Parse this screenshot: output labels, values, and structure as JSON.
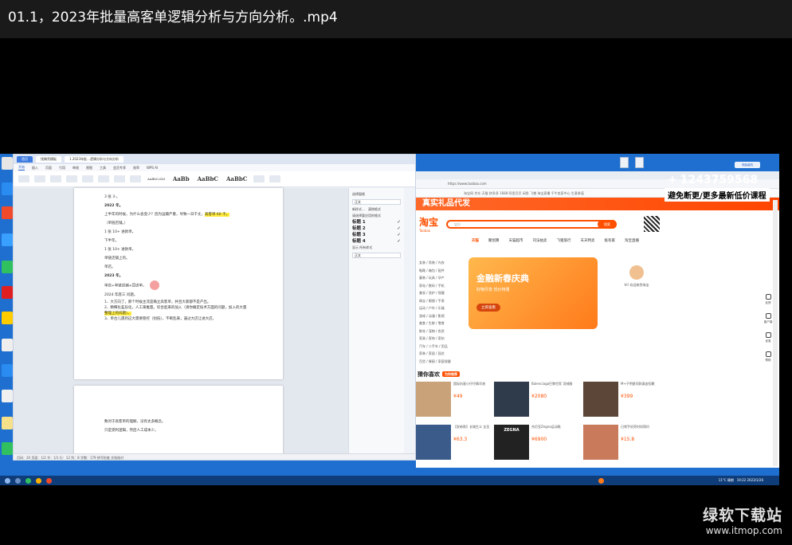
{
  "video_title": "01.1，2023年批量高客单逻辑分析与方向分析。.mp4",
  "doc": {
    "tabs": [
      "首页",
      "找稿壳模板",
      "1.2023年批…逻辑分析与方向分析"
    ],
    "menu": [
      "开始",
      "插入",
      "页面",
      "引用",
      "审阅",
      "视图",
      "工具",
      "会员专享",
      "效率",
      "WPS AI"
    ],
    "style_samples": [
      "AaBbCcDd",
      "AaBb",
      "AaBbC",
      "AaBbC"
    ],
    "page1_lines": [
      {
        "t": "3 张 3-。",
        "b": false
      },
      {
        "t": "2022 年。",
        "b": true
      },
      {
        "t": "上半年的时候，为什么会变少？因为运输严重，导致一日千丈。",
        "b": false,
        "hl": "高客单 60 千。"
      },
      {
        "t": "（单链店铺。）",
        "b": false
      },
      {
        "t": "1 张 10+ 进款单。",
        "b": false
      },
      {
        "t": "下半年。",
        "b": false
      },
      {
        "t": "1 张 10+ 进款单。",
        "b": false
      },
      {
        "t": "单链店铺上的。",
        "b": false
      },
      {
        "t": "单店。",
        "b": false
      },
      {
        "t": "2023 年。",
        "b": true
      },
      {
        "t": "单店+单链店铺+回访单。",
        "b": false
      },
      {
        "t": "",
        "b": false
      },
      {
        "t": "2024 年底三 问题。",
        "b": false
      },
      {
        "t": "1、大方向了，那个时候主流是确立高客单，并且大家都不是产出。",
        "b": false
      },
      {
        "t": "2、精细化差异化，人工来推量。综合起来的加入（请你确定技术方面的问题，加入的大量",
        "b": false
      },
      {
        "t": "整理上的问题）。",
        "b": false
      },
      {
        "t": "3、单台儿遇到这大需要管控（别低），不断乱来，逼过大店让进大店。",
        "b": false
      }
    ],
    "page2_lines": [
      "数对于高客单的理解，没有太多概念。",
      "只是受利逻辑，然后人工成本少。"
    ],
    "side_panel": {
      "title": "选择窗格",
      "field": "正文",
      "options": [
        "新样式…",
        "清除格式"
      ],
      "label": "请选择要应用的格式",
      "headings": [
        "标题 1",
        "标题 2",
        "标题 3",
        "标题 4"
      ],
      "show_label": "显示 所有样式",
      "show_value": "正文"
    },
    "status": "页码：20  页面：1/2  节：1/1  行：12  列：8  字数：179  拼写检查  文档校对"
  },
  "browser": {
    "nav_text": "https://www.taobao.com",
    "bookmarks": "淘宝网 京东 天猫 拼多多 1688 阿里巴巴 闲鱼 飞猪 淘宝直播 千牛卖家中心 生意参谋",
    "promo_text": "真实礼品代发",
    "logo": "淘宝",
    "logo_sub": "Taobao",
    "search_placeholder": "宝贝",
    "search_button": "搜索",
    "categories": [
      "天猫",
      "聚划算",
      "天猫超市",
      "司法拍卖",
      "飞猪旅行",
      "天天特卖",
      "极有家",
      "淘宝直播"
    ],
    "left_categories": [
      "女装 / 男装 / 内衣",
      "鞋靴 / 箱包 / 配件",
      "童装 / 玩具 / 孕产",
      "家电 / 数码 / 手机",
      "美妆 / 洗护 / 保健",
      "珠宝 / 眼镜 / 手表",
      "运动 / 户外 / 乐器",
      "游戏 / 动漫 / 影视",
      "美食 / 生鲜 / 零食",
      "鲜花 / 宠物 / 农资",
      "家具 / 家饰 / 家纺",
      "汽车 / 二手车 / 用品",
      "家装 / 家居 / 园艺",
      "百货 / 餐厨 / 家庭保健"
    ],
    "banner_title": "金融新春庆典",
    "banner_sub": "好物尽享 低价特惠",
    "banner_btn": "立即查看",
    "user_greeting": "Hi! 欢迎来到淘宝",
    "rec_title": "猜你喜欢",
    "rec_tag": "为你推荐",
    "products": [
      {
        "title": "国际抗衰小仔仔精华液",
        "price": "¥49",
        "color": "#c9a27a"
      },
      {
        "title": "Balenciaga巴黎世家 羽绒服",
        "price": "¥2080",
        "color": "#2f3b4a"
      },
      {
        "title": "M+子明星同款真皮短靴",
        "price": "¥399",
        "color": "#5b4638"
      },
      {
        "title": "【发新款】长城生义 全员",
        "price": "¥63.3",
        "color": "#3b5c8a"
      },
      {
        "title": "杰尼亚Zegna运动鞋",
        "price": "¥6900",
        "color": "#222222"
      },
      {
        "title": "日常手机壳时尚简约",
        "price": "¥15.8",
        "color": "#c97a5b"
      }
    ],
    "zegna_label": "ZEGNA",
    "tools": [
      "反馈",
      "客户端",
      "优惠",
      "帮助"
    ]
  },
  "promo": {
    "phone": "1243759568",
    "plus": "+",
    "line": "避免断更/更多最新低价课程"
  },
  "watermark": {
    "logo": "绿软下载站",
    "url": "www.itmop.com"
  },
  "taskbar": {
    "clock": "19:22  2023/1/26",
    "weather": "11°C 晴朗"
  },
  "desktop_button": "电脑装机"
}
